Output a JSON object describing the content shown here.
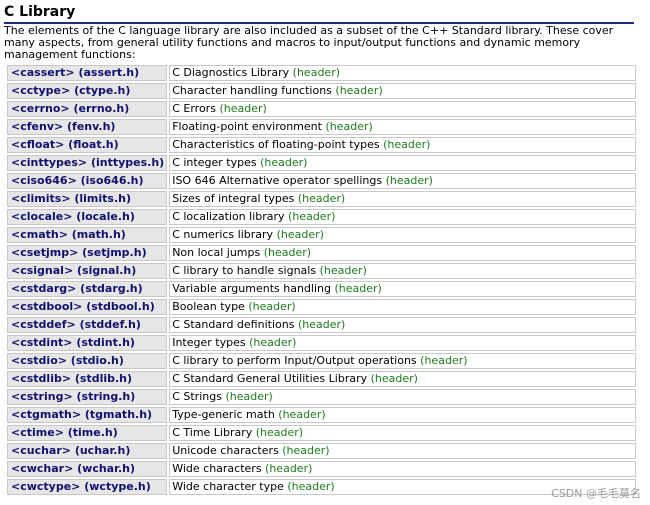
{
  "page": {
    "title": "C Library",
    "intro": "The elements of the C language library are also included as a subset of the C++ Standard library. These cover many aspects, from general utility functions and macros to input/output functions and dynamic memory management functions:",
    "header_label": "(header)",
    "watermark": "CSDN @毛毛莫名"
  },
  "libraries": [
    {
      "name": "<cassert> (assert.h)",
      "description": "C Diagnostics Library"
    },
    {
      "name": "<cctype> (ctype.h)",
      "description": "Character handling functions"
    },
    {
      "name": "<cerrno> (errno.h)",
      "description": "C Errors"
    },
    {
      "name": "<cfenv> (fenv.h)",
      "description": "Floating-point environment"
    },
    {
      "name": "<cfloat> (float.h)",
      "description": "Characteristics of floating-point types"
    },
    {
      "name": "<cinttypes> (inttypes.h)",
      "description": "C integer types"
    },
    {
      "name": "<ciso646> (iso646.h)",
      "description": "ISO 646 Alternative operator spellings"
    },
    {
      "name": "<climits> (limits.h)",
      "description": "Sizes of integral types"
    },
    {
      "name": "<clocale> (locale.h)",
      "description": "C localization library"
    },
    {
      "name": "<cmath> (math.h)",
      "description": "C numerics library"
    },
    {
      "name": "<csetjmp> (setjmp.h)",
      "description": "Non local jumps"
    },
    {
      "name": "<csignal> (signal.h)",
      "description": "C library to handle signals"
    },
    {
      "name": "<cstdarg> (stdarg.h)",
      "description": "Variable arguments handling"
    },
    {
      "name": "<cstdbool> (stdbool.h)",
      "description": "Boolean type"
    },
    {
      "name": "<cstddef> (stddef.h)",
      "description": "C Standard definitions"
    },
    {
      "name": "<cstdint> (stdint.h)",
      "description": "Integer types"
    },
    {
      "name": "<cstdio> (stdio.h)",
      "description": "C library to perform Input/Output operations"
    },
    {
      "name": "<cstdlib> (stdlib.h)",
      "description": "C Standard General Utilities Library"
    },
    {
      "name": "<cstring> (string.h)",
      "description": "C Strings"
    },
    {
      "name": "<ctgmath> (tgmath.h)",
      "description": "Type-generic math"
    },
    {
      "name": "<ctime> (time.h)",
      "description": "C Time Library"
    },
    {
      "name": "<cuchar> (uchar.h)",
      "description": "Unicode characters"
    },
    {
      "name": "<cwchar> (wchar.h)",
      "description": "Wide characters"
    },
    {
      "name": "<cwctype> (wctype.h)",
      "description": "Wide character type"
    }
  ]
}
